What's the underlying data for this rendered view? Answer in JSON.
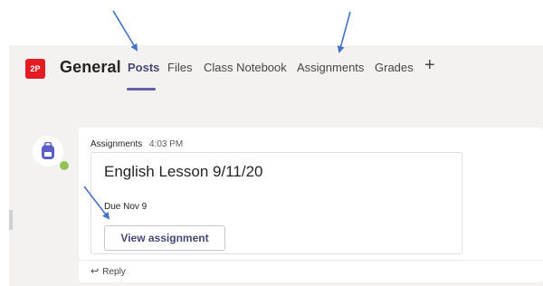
{
  "header": {
    "team_avatar_text": "2P",
    "team_avatar_color": "#e31b23",
    "channel_name": "General",
    "tabs": [
      {
        "label": "Posts",
        "active": true
      },
      {
        "label": "Files",
        "active": false
      },
      {
        "label": "Class Notebook",
        "active": false
      },
      {
        "label": "Assignments",
        "active": false
      },
      {
        "label": "Grades",
        "active": false
      }
    ],
    "add_tab_icon": "plus-icon",
    "accent_color": "#6264a7"
  },
  "post": {
    "sender": "Assignments",
    "time": "4:03 PM",
    "avatar_icon": "backpack-icon",
    "presence_status_color": "#92c353",
    "card": {
      "title": "English Lesson 9/11/20",
      "due": "Due Nov 9",
      "button_label": "View assignment"
    },
    "reply_label": "Reply",
    "reply_icon": "reply-arrow-icon"
  },
  "annotations": {
    "arrow_color": "#4472c4",
    "arrow_icon": "arrow-icon"
  }
}
